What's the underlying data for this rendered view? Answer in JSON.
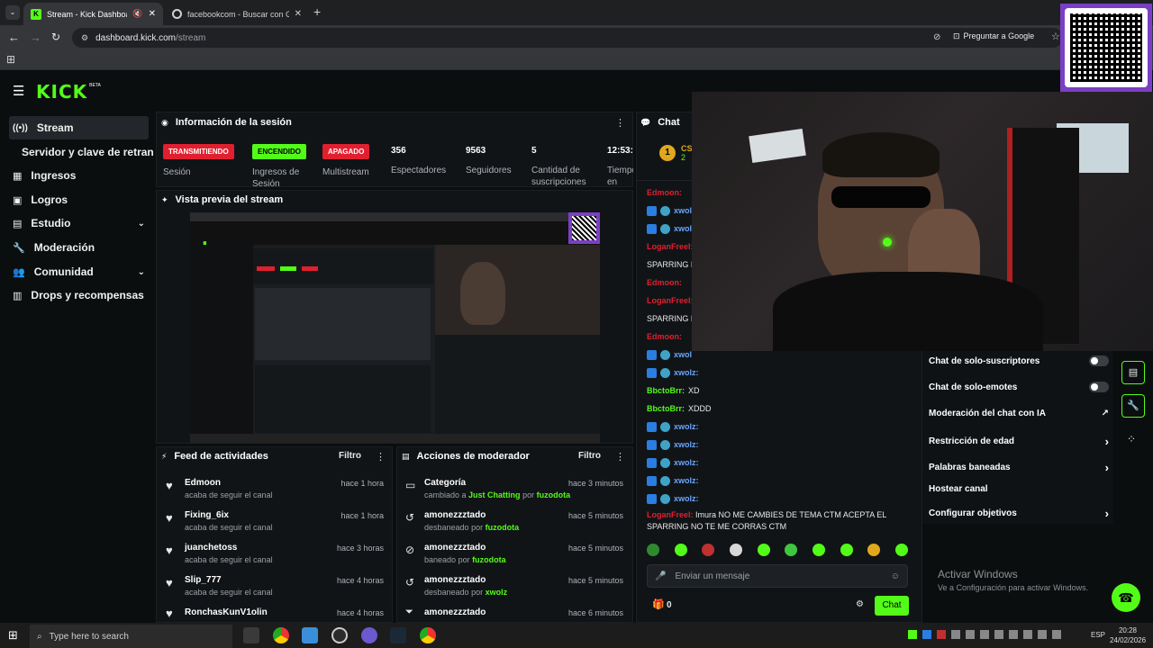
{
  "browser": {
    "tabs": [
      {
        "title": "Stream - Kick Dashboard",
        "active": true
      },
      {
        "title": "facebookcom - Buscar con Goo",
        "active": false
      }
    ],
    "url_domain": "dashboard.kick.com",
    "url_path": "/stream",
    "ask_google": "Preguntar a Google"
  },
  "brand": {
    "logo": "KICK",
    "beta": "BETA"
  },
  "sidebar": {
    "items": [
      {
        "label": "Stream",
        "icon": "broadcast-icon"
      },
      {
        "label": "Servidor y clave de retransm"
      },
      {
        "label": "Ingresos",
        "icon": "chart-icon"
      },
      {
        "label": "Logros",
        "icon": "trophy-icon"
      },
      {
        "label": "Estudio",
        "icon": "studio-icon"
      },
      {
        "label": "Moderación",
        "icon": "wrench-icon"
      },
      {
        "label": "Comunidad",
        "icon": "users-icon"
      },
      {
        "label": "Drops y recompensas",
        "icon": "gift-icon"
      }
    ]
  },
  "session": {
    "title": "Información de la sesión",
    "stats": [
      {
        "value": "TRANSMITIENDO",
        "label": "Sesión",
        "color": "#e0202f"
      },
      {
        "value": "ENCENDIDO",
        "label": "Ingresos de Sesión",
        "color": "#53fc18"
      },
      {
        "value": "APAGADO",
        "label": "Multistream",
        "color": "#e0202f"
      },
      {
        "value": "356",
        "label": "Espectadores"
      },
      {
        "value": "9563",
        "label": "Seguidores"
      },
      {
        "value": "5",
        "label": "Cantidad de suscripciones"
      },
      {
        "value": "12:53:",
        "label": "Tiempo en vivo"
      }
    ]
  },
  "preview": {
    "title": "Vista previa del stream"
  },
  "activity": {
    "title": "Feed de actividades",
    "filter": "Filtro",
    "items": [
      {
        "name": "Edmoon",
        "sub": "acaba de seguir el canal",
        "time": "hace 1 hora"
      },
      {
        "name": "Fixing_6ix",
        "sub": "acaba de seguir el canal",
        "time": "hace 1 hora"
      },
      {
        "name": "juanchetoss",
        "sub": "acaba de seguir el canal",
        "time": "hace 3 horas"
      },
      {
        "name": "Slip_777",
        "sub": "acaba de seguir el canal",
        "time": "hace 4 horas"
      },
      {
        "name": "RonchasKunV1olin",
        "sub": "",
        "time": "hace 4 horas"
      }
    ]
  },
  "modactions": {
    "title": "Acciones de moderador",
    "filter": "Filtro",
    "items": [
      {
        "name": "Categoría",
        "pre": "cambiado a",
        "target": "Just Chatting",
        "mid": "por",
        "by": "fuzodota",
        "time": "hace 3 minutos",
        "icon": "category-icon"
      },
      {
        "name": "amonezzztado",
        "pre": "desbaneado",
        "target": "",
        "mid": "por",
        "by": "fuzodota",
        "time": "hace 5 minutos",
        "icon": "undo-icon"
      },
      {
        "name": "amonezzztado",
        "pre": "baneado",
        "target": "",
        "mid": "por",
        "by": "fuzodota",
        "time": "hace 5 minutos",
        "icon": "ban-icon"
      },
      {
        "name": "amonezzztado",
        "pre": "desbaneado",
        "target": "",
        "mid": "por",
        "by": "xwolz",
        "time": "hace 5 minutos",
        "icon": "undo-icon"
      },
      {
        "name": "amonezzztado",
        "pre": "",
        "target": "",
        "mid": "",
        "by": "",
        "time": "hace 6 minutos",
        "icon": "filter-icon"
      }
    ]
  },
  "chat": {
    "title": "Chat",
    "pinned_name": "CS",
    "pinned_count": "2",
    "pinned_rank": "1",
    "messages": [
      {
        "user": "Edmoon:",
        "text": "",
        "color": "#e0202f"
      },
      {
        "user": "xwol",
        "text": "",
        "color": "#6aa7ff"
      },
      {
        "user": "xwol",
        "text": "",
        "color": "#6aa7ff"
      },
      {
        "user": "LoganFreel:",
        "text": "",
        "color": "#e0202f"
      },
      {
        "user": "",
        "text": "SPARRING N",
        "color": "#e0202f"
      },
      {
        "user": "Edmoon:",
        "text": "",
        "color": "#e0202f"
      },
      {
        "user": "LoganFreel:",
        "text": "",
        "color": "#e0202f"
      },
      {
        "user": "",
        "text": "SPARRING N",
        "color": "#e0202f"
      },
      {
        "user": "Edmoon:",
        "text": "",
        "color": "#e0202f"
      },
      {
        "user": "xwol",
        "text": "",
        "color": "#6aa7ff"
      },
      {
        "user": "xwolz:",
        "text": "",
        "color": "#6aa7ff"
      },
      {
        "user": "BbctoBrr:",
        "text": "XD",
        "color": "#53fc18"
      },
      {
        "user": "BbctoBrr:",
        "text": "XDDD",
        "color": "#53fc18"
      },
      {
        "user": "xwolz:",
        "text": "",
        "color": "#6aa7ff"
      },
      {
        "user": "xwolz:",
        "text": "",
        "color": "#6aa7ff"
      },
      {
        "user": "xwolz:",
        "text": "",
        "color": "#6aa7ff"
      },
      {
        "user": "xwolz:",
        "text": "",
        "color": "#6aa7ff"
      },
      {
        "user": "xwolz:",
        "text": "",
        "color": "#6aa7ff"
      }
    ],
    "last_user": "LoganFreel:",
    "last_text": "Imura NO ME CAMBIES DE TEMA CTM ACEPTA EL SPARRING NO TE ME CORRAS CTM",
    "placeholder": "Enviar un mensaje",
    "points": "0",
    "send": "Chat"
  },
  "chat_settings": [
    {
      "label": "Chat de solo-suscriptores",
      "control": "toggle"
    },
    {
      "label": "Chat de solo-emotes",
      "control": "toggle"
    },
    {
      "label": "Moderación del chat con IA",
      "control": "external"
    },
    {
      "label": "Restricción de edad",
      "control": "chevron"
    },
    {
      "label": "Palabras baneadas",
      "control": "chevron"
    },
    {
      "label": "Hostear canal",
      "control": "none"
    },
    {
      "label": "Configurar objetivos",
      "control": "chevron"
    }
  ],
  "watermark": {
    "line1": "Activar Windows",
    "line2": "Ve a Configuración para activar Windows."
  },
  "taskbar": {
    "search": "Type here to search",
    "lang": "ESP",
    "time": "20:28",
    "date": "24/02/2026"
  },
  "colors": {
    "accent": "#53fc18",
    "danger": "#e0202f",
    "bg": "#0b0e0f"
  }
}
